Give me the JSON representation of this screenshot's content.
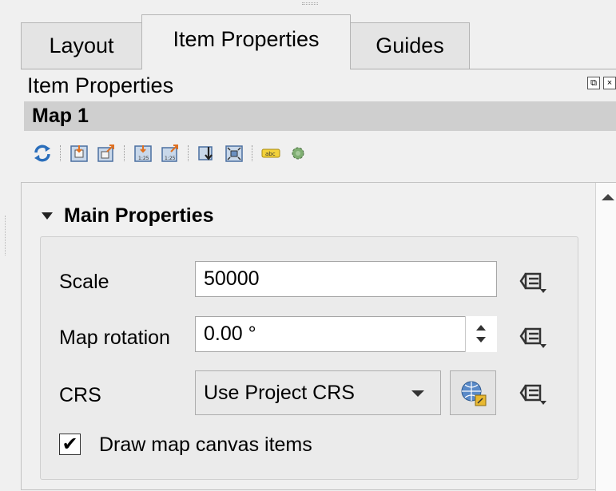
{
  "tabs": [
    {
      "label": "Layout",
      "active": false
    },
    {
      "label": "Item Properties",
      "active": true
    },
    {
      "label": "Guides",
      "active": false
    }
  ],
  "panel": {
    "title": "Item Properties",
    "item_name": "Map 1"
  },
  "toolbar": {
    "icons": [
      "refresh-icon",
      "set-extent-from-canvas-icon",
      "view-extent-in-canvas-icon",
      "set-scale-from-canvas-icon",
      "set-canvas-scale-icon",
      "move-content-icon",
      "zoom-content-icon",
      "label-settings-icon",
      "clip-settings-icon"
    ]
  },
  "main_properties": {
    "title": "Main Properties",
    "scale": {
      "label": "Scale",
      "value": "50000"
    },
    "rotation": {
      "label": "Map rotation",
      "value": "0.00 °"
    },
    "crs": {
      "label": "CRS",
      "value": "Use Project CRS"
    },
    "draw_canvas_items": {
      "label": "Draw map canvas items",
      "checked": true,
      "mark": "✔"
    }
  },
  "colors": {
    "accent_blue": "#2a6ebb",
    "icon_orange": "#e07020",
    "header_bg": "#cfcfcf"
  }
}
